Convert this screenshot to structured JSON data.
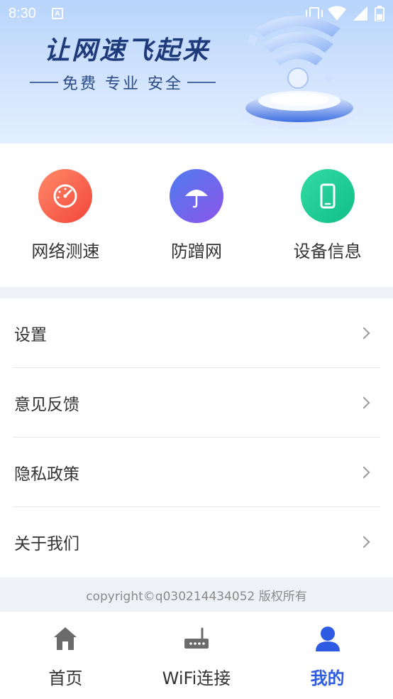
{
  "status_bar": {
    "time": "8:30",
    "a_icon_letter": "A"
  },
  "banner": {
    "headline": "让网速飞起来",
    "subline": "免费 专业 安全"
  },
  "tools": [
    {
      "label": "网络测速",
      "icon": "speedometer-icon",
      "color_from": "#ff8a6a",
      "color_to": "#f2463a"
    },
    {
      "label": "防蹭网",
      "icon": "umbrella-icon",
      "color_from": "#4f7cf0",
      "color_to": "#8c55e8"
    },
    {
      "label": "设备信息",
      "icon": "phone-icon",
      "color_from": "#33dba3",
      "color_to": "#0fbf86"
    }
  ],
  "menu": [
    {
      "label": "设置"
    },
    {
      "label": "意见反馈"
    },
    {
      "label": "隐私政策"
    },
    {
      "label": "关于我们"
    }
  ],
  "copyright": "copyright©q030214434052 版权所有",
  "nav": [
    {
      "label": "首页",
      "icon": "home-icon",
      "active": false
    },
    {
      "label": "WiFi连接",
      "icon": "router-icon",
      "active": false
    },
    {
      "label": "我的",
      "icon": "user-icon",
      "active": true
    }
  ],
  "colors": {
    "accent": "#2d5be3",
    "band": "#eef1f6",
    "headline": "#1e3a7b"
  }
}
